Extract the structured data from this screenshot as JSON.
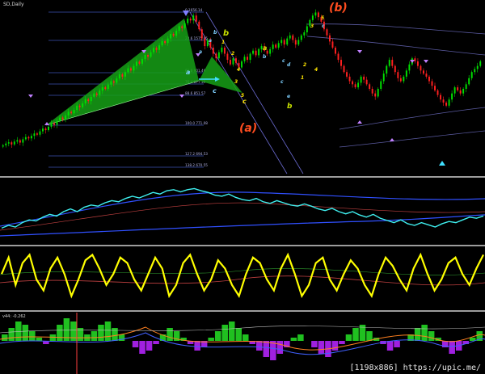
{
  "header": {
    "symbol_label": "SD,Daily"
  },
  "indicator4_label": "v44: -0.262",
  "watermark": "[1198x886] https://upic.me/",
  "fib_labels": [
    "0 1656.14",
    "23.6 1575.05",
    "61.8 901.49",
    "76.4 877.39",
    "88.6 851.57",
    "100.0 771.08",
    "127.2 694.53",
    "138.2 670.55"
  ],
  "wave_labels": [
    {
      "t": "(b)",
      "c": "#ff4d1f"
    },
    {
      "t": "(a)",
      "c": "#ff4d1f"
    },
    {
      "t": "b",
      "c": "#c8e000"
    },
    {
      "t": "a",
      "c": "#c8e000"
    },
    {
      "t": "b",
      "c": "#c8e000"
    },
    {
      "t": "a",
      "c": "#7fd0ff"
    },
    {
      "t": "c",
      "c": "#7fd0ff"
    },
    {
      "t": "1",
      "c": "#ffe600"
    },
    {
      "t": "2",
      "c": "#ffe600"
    },
    {
      "t": "3",
      "c": "#ffe600"
    },
    {
      "t": "4",
      "c": "#ffe600"
    },
    {
      "t": "5",
      "c": "#ffe600"
    },
    {
      "t": "1",
      "c": "#ffe600"
    },
    {
      "t": "2",
      "c": "#ffe600"
    },
    {
      "t": "3",
      "c": "#ffe600"
    },
    {
      "t": "4",
      "c": "#ffe600"
    },
    {
      "t": "5",
      "c": "#ffe600"
    },
    {
      "t": "a",
      "c": "#7fd0ff"
    },
    {
      "t": "b",
      "c": "#7fd0ff"
    },
    {
      "t": "c",
      "c": "#ffe600"
    },
    {
      "t": "a",
      "c": "#7fd0ff"
    },
    {
      "t": "b",
      "c": "#7fd0ff"
    },
    {
      "t": "c",
      "c": "#7fd0ff"
    },
    {
      "t": "c",
      "c": "#7fd0ff"
    },
    {
      "t": "d",
      "c": "#7fd0ff"
    },
    {
      "t": "e",
      "c": "#7fd0ff"
    },
    {
      "t": "c",
      "c": "#7fd0ff"
    }
  ],
  "colors": {
    "bull": "#00e000",
    "bear": "#ff2020",
    "pattern": "#16a016",
    "fib": "#3a4fb0",
    "channel": "#6a6ad0",
    "cyan": "#3ff0f0",
    "yellow": "#ffff00",
    "osc_blue": "#3050ff",
    "hist_pos": "#20c020",
    "hist_neg": "#a020e0",
    "panel_sep": "#d0d0d0"
  },
  "chart_data": [
    {
      "type": "candlestick",
      "name": "price",
      "title": "",
      "close": [
        780,
        792,
        800,
        786,
        805,
        814,
        798,
        820,
        834,
        826,
        842,
        858,
        850,
        872,
        890,
        880,
        902,
        925,
        915,
        940,
        962,
        950,
        976,
        1000,
        990,
        1012,
        1040,
        1030,
        1055,
        1082,
        1070,
        1098,
        1120,
        1110,
        1138,
        1160,
        1150,
        1178,
        1200,
        1190,
        1218,
        1245,
        1230,
        1260,
        1285,
        1270,
        1300,
        1328,
        1315,
        1345,
        1372,
        1360,
        1390,
        1418,
        1405,
        1435,
        1462,
        1450,
        1480,
        1510,
        1498,
        1530,
        1560,
        1548,
        1580,
        1610,
        1598,
        1630,
        1590,
        1540,
        1480,
        1430,
        1470,
        1420,
        1380,
        1350,
        1390,
        1420,
        1380,
        1340,
        1310,
        1350,
        1320,
        1290,
        1330,
        1360,
        1340,
        1380,
        1400,
        1370,
        1410,
        1430,
        1400,
        1380,
        1410,
        1440,
        1420,
        1450,
        1470,
        1440,
        1480,
        1500,
        1470,
        1440,
        1470,
        1500,
        1520,
        1560,
        1600,
        1630,
        1650,
        1620,
        1590,
        1540,
        1500,
        1460,
        1420,
        1380,
        1340,
        1300,
        1260,
        1230,
        1200,
        1180,
        1160,
        1190,
        1230,
        1210,
        1180,
        1150,
        1120,
        1100,
        1150,
        1200,
        1250,
        1300,
        1340,
        1300,
        1260,
        1220,
        1200,
        1230,
        1270,
        1310,
        1350,
        1330,
        1300,
        1270,
        1250,
        1230,
        1200,
        1170,
        1140,
        1110,
        1080,
        1060,
        1040,
        1080,
        1120,
        1160,
        1140,
        1120,
        1150,
        1180,
        1220,
        1260,
        1280,
        1300,
        1330
      ],
      "ylim": [
        600,
        1700
      ]
    },
    {
      "type": "line",
      "name": "indicator-2",
      "values": [
        0.2,
        0.25,
        0.22,
        0.3,
        0.35,
        0.33,
        0.4,
        0.45,
        0.42,
        0.5,
        0.55,
        0.5,
        0.58,
        0.62,
        0.6,
        0.66,
        0.7,
        0.68,
        0.74,
        0.78,
        0.75,
        0.8,
        0.85,
        0.82,
        0.88,
        0.9,
        0.86,
        0.9,
        0.92,
        0.88,
        0.85,
        0.8,
        0.78,
        0.82,
        0.76,
        0.72,
        0.7,
        0.74,
        0.68,
        0.65,
        0.7,
        0.66,
        0.62,
        0.6,
        0.64,
        0.6,
        0.55,
        0.52,
        0.56,
        0.5,
        0.46,
        0.5,
        0.44,
        0.4,
        0.45,
        0.38,
        0.34,
        0.3,
        0.35,
        0.28,
        0.25,
        0.3,
        0.26,
        0.22,
        0.28,
        0.32,
        0.3,
        0.35,
        0.4,
        0.38,
        0.42
      ],
      "ylim": [
        0,
        1
      ]
    },
    {
      "type": "line",
      "name": "indicator-3",
      "values": [
        0.6,
        0.9,
        0.4,
        0.8,
        0.95,
        0.5,
        0.3,
        0.7,
        0.9,
        0.6,
        0.2,
        0.5,
        0.85,
        0.95,
        0.7,
        0.4,
        0.6,
        0.9,
        0.8,
        0.5,
        0.3,
        0.6,
        0.9,
        0.7,
        0.2,
        0.4,
        0.8,
        0.95,
        0.6,
        0.3,
        0.5,
        0.85,
        0.7,
        0.4,
        0.2,
        0.6,
        0.9,
        0.8,
        0.5,
        0.3,
        0.7,
        0.95,
        0.6,
        0.2,
        0.4,
        0.8,
        0.9,
        0.5,
        0.3,
        0.6,
        0.85,
        0.7,
        0.4,
        0.2,
        0.6,
        0.9,
        0.75,
        0.5,
        0.3,
        0.7,
        0.95,
        0.6,
        0.3,
        0.5,
        0.8,
        0.9,
        0.6,
        0.4,
        0.7,
        0.95
      ],
      "ylim": [
        0,
        1
      ]
    },
    {
      "type": "bar",
      "name": "indicator-4",
      "values": [
        0.2,
        0.4,
        0.6,
        0.5,
        0.3,
        0.1,
        -0.1,
        0.2,
        0.5,
        0.7,
        0.6,
        0.4,
        0.2,
        0.3,
        0.5,
        0.6,
        0.4,
        0.2,
        0,
        -0.2,
        -0.4,
        -0.3,
        -0.1,
        0.2,
        0.4,
        0.3,
        0.1,
        -0.1,
        -0.3,
        -0.2,
        0.1,
        0.3,
        0.5,
        0.6,
        0.4,
        0.2,
        -0.1,
        -0.3,
        -0.5,
        -0.6,
        -0.4,
        -0.2,
        0.1,
        0.2,
        0,
        -0.2,
        -0.4,
        -0.5,
        -0.3,
        -0.1,
        0.2,
        0.4,
        0.5,
        0.3,
        0.1,
        -0.1,
        -0.3,
        -0.2,
        0,
        0.2,
        0.4,
        0.5,
        0.3,
        0.1,
        -0.2,
        -0.4,
        -0.3,
        -0.1,
        0.1,
        0.3
      ],
      "ylim": [
        -0.7,
        0.8
      ]
    }
  ]
}
